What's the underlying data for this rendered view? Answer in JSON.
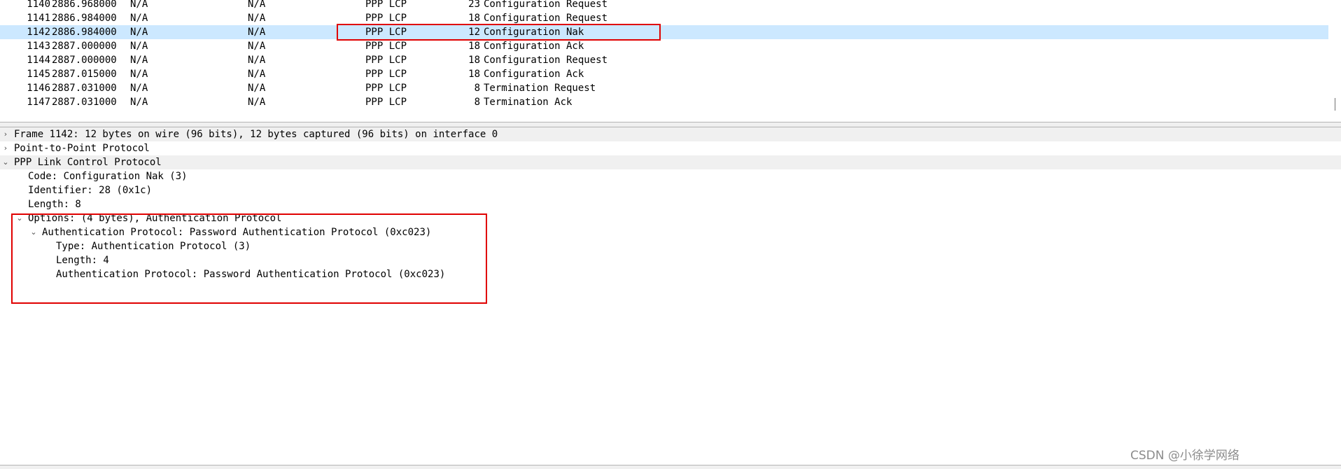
{
  "packet_list": {
    "rows": [
      {
        "no": "1140",
        "time": "2886.968000",
        "source": "N/A",
        "destination": "N/A",
        "protocol": "PPP LCP",
        "length": "23",
        "info": "Configuration Request"
      },
      {
        "no": "1141",
        "time": "2886.984000",
        "source": "N/A",
        "destination": "N/A",
        "protocol": "PPP LCP",
        "length": "18",
        "info": "Configuration Request"
      },
      {
        "no": "1142",
        "time": "2886.984000",
        "source": "N/A",
        "destination": "N/A",
        "protocol": "PPP LCP",
        "length": "12",
        "info": "Configuration Nak",
        "selected": true
      },
      {
        "no": "1143",
        "time": "2887.000000",
        "source": "N/A",
        "destination": "N/A",
        "protocol": "PPP LCP",
        "length": "18",
        "info": "Configuration Ack"
      },
      {
        "no": "1144",
        "time": "2887.000000",
        "source": "N/A",
        "destination": "N/A",
        "protocol": "PPP LCP",
        "length": "18",
        "info": "Configuration Request"
      },
      {
        "no": "1145",
        "time": "2887.015000",
        "source": "N/A",
        "destination": "N/A",
        "protocol": "PPP LCP",
        "length": "18",
        "info": "Configuration Ack"
      },
      {
        "no": "1146",
        "time": "2887.031000",
        "source": "N/A",
        "destination": "N/A",
        "protocol": "PPP LCP",
        "length": "8",
        "info": "Termination Request"
      },
      {
        "no": "1147",
        "time": "2887.031000",
        "source": "N/A",
        "destination": "N/A",
        "protocol": "PPP LCP",
        "length": "8",
        "info": "Termination Ack"
      }
    ]
  },
  "details": {
    "frame": "Frame 1142: 12 bytes on wire (96 bits), 12 bytes captured (96 bits) on interface 0",
    "ppp": "Point-to-Point Protocol",
    "lcp": "PPP Link Control Protocol",
    "code": "Code: Configuration Nak (3)",
    "identifier": "Identifier: 28 (0x1c)",
    "length": "Length: 8",
    "options": "Options: (4 bytes), Authentication Protocol",
    "auth_option": "Authentication Protocol: Password Authentication Protocol (0xc023)",
    "auth_type": "Type: Authentication Protocol (3)",
    "auth_length": "Length: 4",
    "auth_value": "Authentication Protocol: Password Authentication Protocol (0xc023)"
  },
  "icons": {
    "collapsed": "chevron-right-icon",
    "expanded": "chevron-down-icon"
  },
  "colors": {
    "selection": "#cce8ff",
    "annotation": "#e00000",
    "band": "#f0f0f0"
  },
  "watermark": "CSDN @小徐学网络"
}
